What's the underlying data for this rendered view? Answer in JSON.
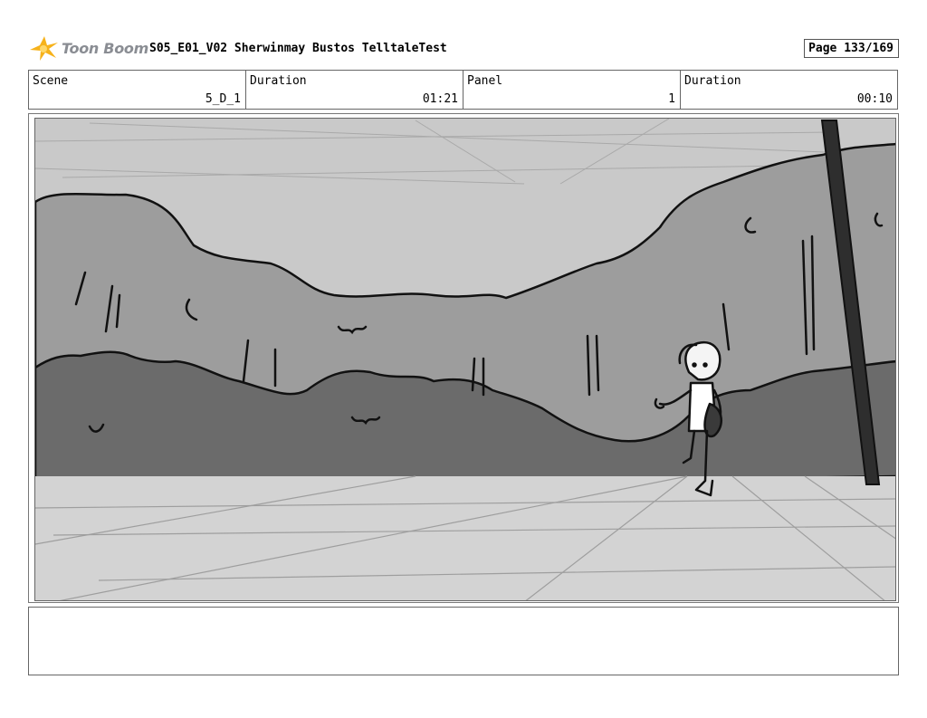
{
  "header": {
    "logo_text": "Toon Boom",
    "title": "S05_E01_V02  Sherwinmay Bustos TelltaleTest",
    "page": "Page 133/169"
  },
  "info": {
    "scene_label": "Scene",
    "scene_value": "5_D_1",
    "scene_duration_label": "Duration",
    "scene_duration_value": "01:21",
    "panel_label": "Panel",
    "panel_value": "1",
    "panel_duration_label": "Duration",
    "panel_duration_value": "00:10"
  },
  "panel": {
    "description": "",
    "colors": {
      "sky": "#c9c9c9",
      "hills": "#9d9d9d",
      "bushes": "#6b6b6b",
      "ground": "#d3d3d3",
      "pole": "#2e2e2e"
    }
  },
  "notes": {
    "text": ""
  }
}
